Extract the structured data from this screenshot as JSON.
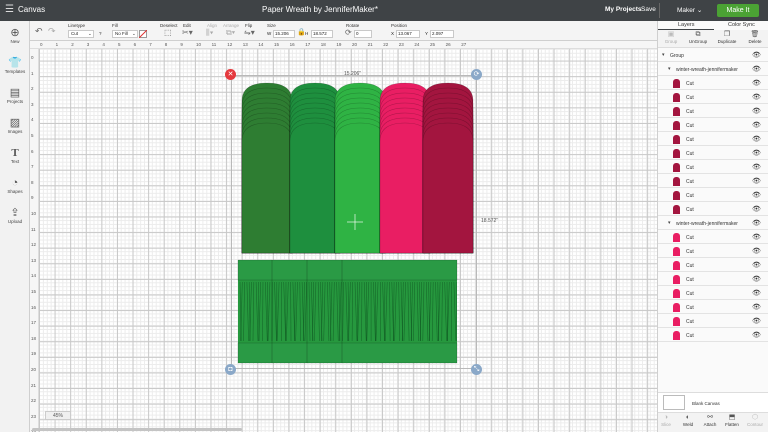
{
  "window": {
    "menu_icon": "hamburger-icon",
    "app_name": "Canvas",
    "title": "Paper Wreath by JenniferMaker*",
    "my_projects": "My Projects",
    "save": "Save",
    "machine": "Maker",
    "make_it": "Make It"
  },
  "toolbar": {
    "linetype_label": "Linetype",
    "linetype_value": "Cut",
    "fill_label": "Fill",
    "fill_value": "No Fill",
    "deselect_label": "Deselect",
    "edit_label": "Edit",
    "align_label": "Align",
    "arrange_label": "Arrange",
    "flip_label": "Flip",
    "size_label": "Size",
    "w_label": "W",
    "w_value": "15.206",
    "h_label": "H",
    "h_value": "18.572",
    "rotate_label": "Rotate",
    "rotate_value": "0",
    "position_label": "Position",
    "x_label": "X",
    "x_value": "13.067",
    "y_label": "Y",
    "y_value": "2.097"
  },
  "left_nav": [
    {
      "label": "New",
      "icon": "plus-icon"
    },
    {
      "label": "Templates",
      "icon": "shirt-icon"
    },
    {
      "label": "Projects",
      "icon": "projects-icon"
    },
    {
      "label": "Images",
      "icon": "images-icon"
    },
    {
      "label": "Text",
      "icon": "text-icon"
    },
    {
      "label": "Shapes",
      "icon": "shapes-icon"
    },
    {
      "label": "Upload",
      "icon": "upload-icon"
    }
  ],
  "ruler": {
    "top": [
      "0",
      "1",
      "2",
      "3",
      "4",
      "5",
      "6",
      "7",
      "8",
      "9",
      "10",
      "11",
      "12",
      "13",
      "14",
      "15",
      "16",
      "17",
      "18",
      "19",
      "20",
      "21",
      "22",
      "23",
      "24",
      "25",
      "26",
      "27"
    ],
    "left": [
      "0",
      "1",
      "2",
      "3",
      "4",
      "5",
      "6",
      "7",
      "8",
      "9",
      "10",
      "11",
      "12",
      "13",
      "14",
      "15",
      "16",
      "17",
      "18",
      "19",
      "20",
      "21",
      "22",
      "23",
      "24"
    ]
  },
  "canvas": {
    "width_label": "15.206\"",
    "height_label": "18.572\"",
    "zoom": "45%",
    "leaf_colors": [
      "#2e7d32",
      "#1e8f3e",
      "#2fb344",
      "#e91e63",
      "#a3153f"
    ],
    "band_color": "#26983e",
    "close_icon": "close-icon",
    "rotate_icon": "rotate-icon",
    "lock_icon": "lock-icon",
    "resize_icon": "resize-icon"
  },
  "panel": {
    "tabs": [
      "Layers",
      "Color Sync"
    ],
    "tools": [
      {
        "label": "Group",
        "icon": "group-icon"
      },
      {
        "label": "UnGroup",
        "icon": "ungroup-icon"
      },
      {
        "label": "Duplicate",
        "icon": "duplicate-icon"
      },
      {
        "label": "Delete",
        "icon": "trash-icon"
      }
    ],
    "group_label": "Group",
    "subgroup1": "winter-wreath-jennifermaker",
    "subgroup1_layers": [
      {
        "label": "Cut",
        "color": "#a3153f"
      },
      {
        "label": "Cut",
        "color": "#a3153f"
      },
      {
        "label": "Cut",
        "color": "#a3153f"
      },
      {
        "label": "Cut",
        "color": "#a3153f"
      },
      {
        "label": "Cut",
        "color": "#a3153f"
      },
      {
        "label": "Cut",
        "color": "#a3153f"
      },
      {
        "label": "Cut",
        "color": "#a3153f"
      },
      {
        "label": "Cut",
        "color": "#a3153f"
      },
      {
        "label": "Cut",
        "color": "#a3153f"
      },
      {
        "label": "Cut",
        "color": "#a3153f"
      }
    ],
    "subgroup2": "winter-wreath-jennifermaker",
    "subgroup2_layers": [
      {
        "label": "Cut",
        "color": "#e91e63"
      },
      {
        "label": "Cut",
        "color": "#e91e63"
      },
      {
        "label": "Cut",
        "color": "#e91e63"
      },
      {
        "label": "Cut",
        "color": "#e91e63"
      },
      {
        "label": "Cut",
        "color": "#e91e63"
      },
      {
        "label": "Cut",
        "color": "#e91e63"
      },
      {
        "label": "Cut",
        "color": "#e91e63"
      },
      {
        "label": "Cut",
        "color": "#e91e63"
      }
    ],
    "blank_canvas": "Blank Canvas",
    "footer": [
      {
        "label": "Slice",
        "icon": "slice-icon"
      },
      {
        "label": "Weld",
        "icon": "weld-icon"
      },
      {
        "label": "Attach",
        "icon": "attach-icon"
      },
      {
        "label": "Flatten",
        "icon": "flatten-icon"
      },
      {
        "label": "Contour",
        "icon": "contour-icon"
      }
    ]
  }
}
